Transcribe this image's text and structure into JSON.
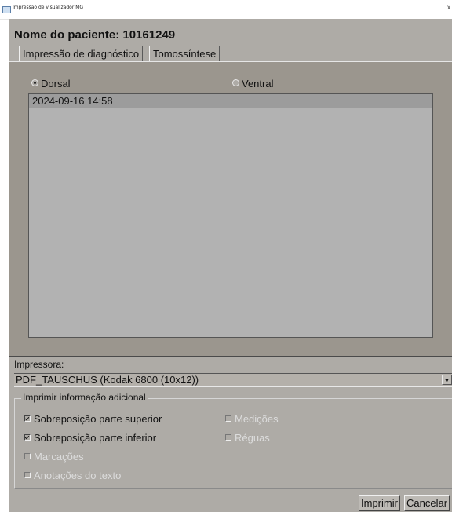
{
  "window": {
    "title": "Impressão de visualizador MG",
    "close_glyph": "x"
  },
  "patient": {
    "title": "Nome do paciente: 10161249"
  },
  "tabs": [
    {
      "label": "Impressão de diagnóstico",
      "active": true
    },
    {
      "label": "Tomossíntese",
      "active": false
    }
  ],
  "view": {
    "options": [
      {
        "label": "Dorsal",
        "selected": true
      },
      {
        "label": "Ventral",
        "selected": false
      }
    ],
    "studies": [
      {
        "label": "2024-09-16 14:58",
        "selected": true
      }
    ]
  },
  "printer": {
    "label": "Impressora:",
    "selected": "PDF_TAUSCHUS (Kodak 6800 (10x12))",
    "arrow": "▼"
  },
  "additional_info": {
    "legend": "Imprimir informação adicional",
    "options": [
      {
        "label": "Sobreposição parte superior",
        "checked": true,
        "enabled": true
      },
      {
        "label": "Sobreposição parte inferior",
        "checked": true,
        "enabled": true
      },
      {
        "label": "Marcações",
        "checked": false,
        "enabled": false
      },
      {
        "label": "Anotações do texto",
        "checked": false,
        "enabled": false
      },
      {
        "label": "Medições",
        "checked": false,
        "enabled": false
      },
      {
        "label": "Réguas",
        "checked": false,
        "enabled": false
      }
    ]
  },
  "buttons": {
    "print_label": "Imprimir",
    "cancel_label": "Cancelar"
  }
}
